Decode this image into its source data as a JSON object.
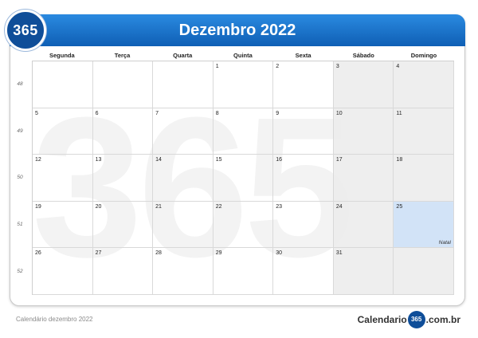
{
  "header": {
    "logo_text": "365",
    "title": "Dezembro 2022"
  },
  "weekdays": [
    "Segunda",
    "Terça",
    "Quarta",
    "Quinta",
    "Sexta",
    "Sábado",
    "Domingo"
  ],
  "weeks": [
    "48",
    "49",
    "50",
    "51",
    "52"
  ],
  "rows": [
    [
      "",
      "",
      "",
      "1",
      "2",
      "3",
      "4"
    ],
    [
      "5",
      "6",
      "7",
      "8",
      "9",
      "10",
      "11"
    ],
    [
      "12",
      "13",
      "14",
      "15",
      "16",
      "17",
      "18"
    ],
    [
      "19",
      "20",
      "21",
      "22",
      "23",
      "24",
      "25"
    ],
    [
      "26",
      "27",
      "28",
      "29",
      "30",
      "31",
      ""
    ]
  ],
  "holiday": {
    "day": "25",
    "note": "Natal"
  },
  "watermark": "365",
  "footer": {
    "caption": "Calendário dezembro 2022",
    "brand_prefix": "Calendario",
    "brand_badge": "365",
    "brand_suffix": ".com.br"
  },
  "colors": {
    "header": "#1a73cf",
    "weekend": "#ebebeb",
    "holiday": "#d2e3f7"
  }
}
